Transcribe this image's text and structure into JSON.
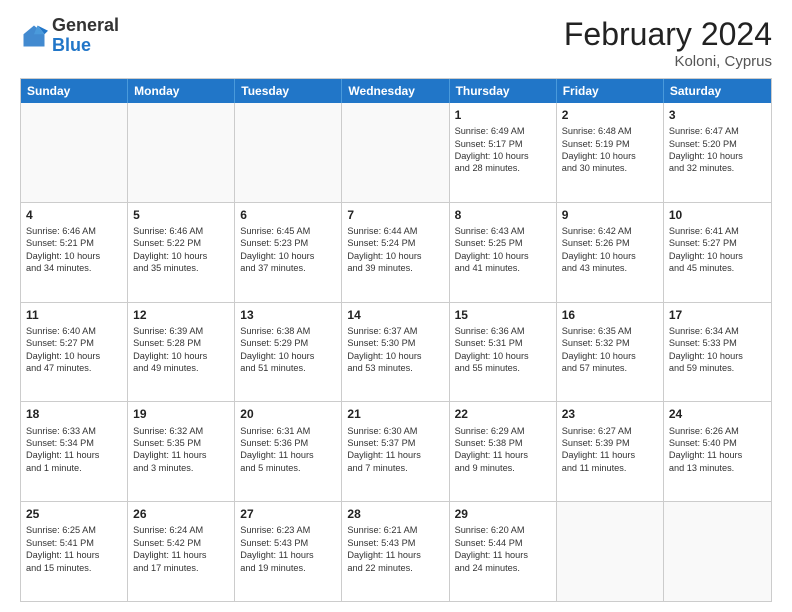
{
  "header": {
    "logo_general": "General",
    "logo_blue": "Blue",
    "month_title": "February 2024",
    "location": "Koloni, Cyprus"
  },
  "weekdays": [
    "Sunday",
    "Monday",
    "Tuesday",
    "Wednesday",
    "Thursday",
    "Friday",
    "Saturday"
  ],
  "rows": [
    [
      {
        "day": "",
        "text": ""
      },
      {
        "day": "",
        "text": ""
      },
      {
        "day": "",
        "text": ""
      },
      {
        "day": "",
        "text": ""
      },
      {
        "day": "1",
        "text": "Sunrise: 6:49 AM\nSunset: 5:17 PM\nDaylight: 10 hours\nand 28 minutes."
      },
      {
        "day": "2",
        "text": "Sunrise: 6:48 AM\nSunset: 5:19 PM\nDaylight: 10 hours\nand 30 minutes."
      },
      {
        "day": "3",
        "text": "Sunrise: 6:47 AM\nSunset: 5:20 PM\nDaylight: 10 hours\nand 32 minutes."
      }
    ],
    [
      {
        "day": "4",
        "text": "Sunrise: 6:46 AM\nSunset: 5:21 PM\nDaylight: 10 hours\nand 34 minutes."
      },
      {
        "day": "5",
        "text": "Sunrise: 6:46 AM\nSunset: 5:22 PM\nDaylight: 10 hours\nand 35 minutes."
      },
      {
        "day": "6",
        "text": "Sunrise: 6:45 AM\nSunset: 5:23 PM\nDaylight: 10 hours\nand 37 minutes."
      },
      {
        "day": "7",
        "text": "Sunrise: 6:44 AM\nSunset: 5:24 PM\nDaylight: 10 hours\nand 39 minutes."
      },
      {
        "day": "8",
        "text": "Sunrise: 6:43 AM\nSunset: 5:25 PM\nDaylight: 10 hours\nand 41 minutes."
      },
      {
        "day": "9",
        "text": "Sunrise: 6:42 AM\nSunset: 5:26 PM\nDaylight: 10 hours\nand 43 minutes."
      },
      {
        "day": "10",
        "text": "Sunrise: 6:41 AM\nSunset: 5:27 PM\nDaylight: 10 hours\nand 45 minutes."
      }
    ],
    [
      {
        "day": "11",
        "text": "Sunrise: 6:40 AM\nSunset: 5:27 PM\nDaylight: 10 hours\nand 47 minutes."
      },
      {
        "day": "12",
        "text": "Sunrise: 6:39 AM\nSunset: 5:28 PM\nDaylight: 10 hours\nand 49 minutes."
      },
      {
        "day": "13",
        "text": "Sunrise: 6:38 AM\nSunset: 5:29 PM\nDaylight: 10 hours\nand 51 minutes."
      },
      {
        "day": "14",
        "text": "Sunrise: 6:37 AM\nSunset: 5:30 PM\nDaylight: 10 hours\nand 53 minutes."
      },
      {
        "day": "15",
        "text": "Sunrise: 6:36 AM\nSunset: 5:31 PM\nDaylight: 10 hours\nand 55 minutes."
      },
      {
        "day": "16",
        "text": "Sunrise: 6:35 AM\nSunset: 5:32 PM\nDaylight: 10 hours\nand 57 minutes."
      },
      {
        "day": "17",
        "text": "Sunrise: 6:34 AM\nSunset: 5:33 PM\nDaylight: 10 hours\nand 59 minutes."
      }
    ],
    [
      {
        "day": "18",
        "text": "Sunrise: 6:33 AM\nSunset: 5:34 PM\nDaylight: 11 hours\nand 1 minute."
      },
      {
        "day": "19",
        "text": "Sunrise: 6:32 AM\nSunset: 5:35 PM\nDaylight: 11 hours\nand 3 minutes."
      },
      {
        "day": "20",
        "text": "Sunrise: 6:31 AM\nSunset: 5:36 PM\nDaylight: 11 hours\nand 5 minutes."
      },
      {
        "day": "21",
        "text": "Sunrise: 6:30 AM\nSunset: 5:37 PM\nDaylight: 11 hours\nand 7 minutes."
      },
      {
        "day": "22",
        "text": "Sunrise: 6:29 AM\nSunset: 5:38 PM\nDaylight: 11 hours\nand 9 minutes."
      },
      {
        "day": "23",
        "text": "Sunrise: 6:27 AM\nSunset: 5:39 PM\nDaylight: 11 hours\nand 11 minutes."
      },
      {
        "day": "24",
        "text": "Sunrise: 6:26 AM\nSunset: 5:40 PM\nDaylight: 11 hours\nand 13 minutes."
      }
    ],
    [
      {
        "day": "25",
        "text": "Sunrise: 6:25 AM\nSunset: 5:41 PM\nDaylight: 11 hours\nand 15 minutes."
      },
      {
        "day": "26",
        "text": "Sunrise: 6:24 AM\nSunset: 5:42 PM\nDaylight: 11 hours\nand 17 minutes."
      },
      {
        "day": "27",
        "text": "Sunrise: 6:23 AM\nSunset: 5:43 PM\nDaylight: 11 hours\nand 19 minutes."
      },
      {
        "day": "28",
        "text": "Sunrise: 6:21 AM\nSunset: 5:43 PM\nDaylight: 11 hours\nand 22 minutes."
      },
      {
        "day": "29",
        "text": "Sunrise: 6:20 AM\nSunset: 5:44 PM\nDaylight: 11 hours\nand 24 minutes."
      },
      {
        "day": "",
        "text": ""
      },
      {
        "day": "",
        "text": ""
      }
    ]
  ]
}
